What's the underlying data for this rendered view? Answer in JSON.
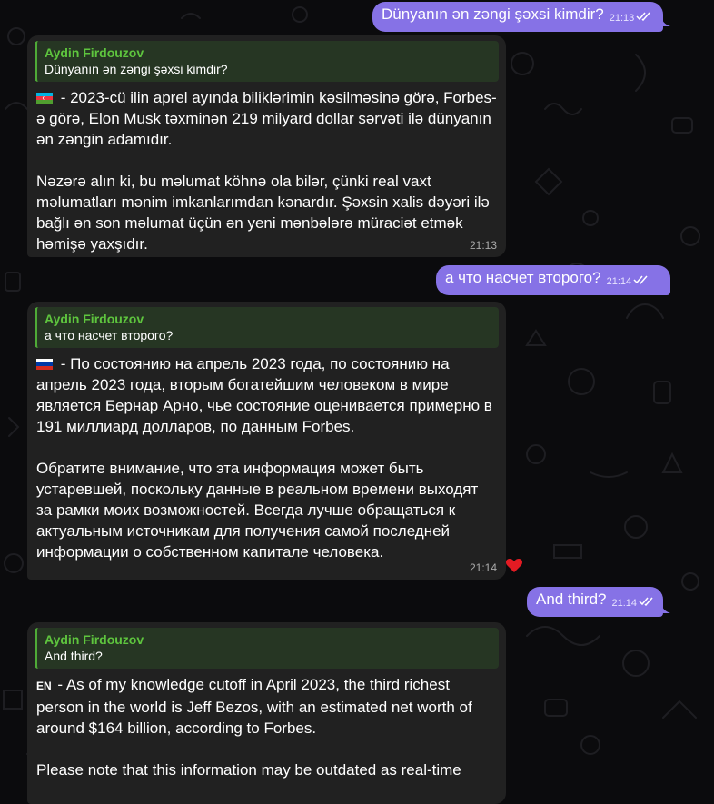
{
  "messages": [
    {
      "type": "outgoing",
      "text": "Dünyanın ən zəngi şəxsi kimdir?",
      "time": "21:13"
    },
    {
      "type": "incoming",
      "reply_name": "Aydin Firdouzov",
      "reply_text": "Dünyanın ən zəngi şəxsi kimdir?",
      "lang_label": "🇦🇿",
      "lang_icon": "azerbaijan-flag-icon",
      "p1": " - 2023-cü ilin aprel ayında biliklərimin kəsilməsinə görə, Forbes-ə görə, Elon Musk təxminən 219 milyard dollar sərvəti ilə dünyanın ən zəngin adamıdır.",
      "p2": "Nəzərə alın ki, bu məlumat köhnə ola bilər, çünki real vaxt məlumatları mənim imkanlarımdan kənardır. Şəxsin xalis dəyəri ilə bağlı ən son məlumat üçün ən yeni mənbələrə müraciət etmək həmişə yaxşıdır.",
      "time": "21:13"
    },
    {
      "type": "outgoing",
      "text": "а что насчет второго?",
      "time": "21:14"
    },
    {
      "type": "incoming",
      "reply_name": "Aydin Firdouzov",
      "reply_text": "а что насчет второго?",
      "lang_label": "🇷🇺",
      "lang_icon": "russia-flag-icon",
      "p1": " - По состоянию на апрель 2023 года, по состоянию на апрель 2023 года, вторым богатейшим человеком в мире является Бернар Арно, чье состояние оценивается примерно в 191 миллиард долларов, по данным Forbes.",
      "p2": "Обратите внимание, что эта информация может быть устаревшей, поскольку данные в реальном времени выходят за рамки моих возможностей. Всегда лучше обращаться к актуальным источникам для получения самой последней информации о собственном капитале человека.",
      "time": "21:14",
      "reaction": "❤️"
    },
    {
      "type": "outgoing",
      "text": "And third?",
      "time": "21:14"
    },
    {
      "type": "incoming",
      "reply_name": "Aydin Firdouzov",
      "reply_text": "And third?",
      "lang_label": "EN",
      "p1": " - As of my knowledge cutoff in April 2023, the third richest person in the world is Jeff Bezos, with an estimated net worth of around $164 billion, according to Forbes.",
      "p2": "Please note that this information may be outdated as real-time"
    }
  ],
  "colors": {
    "outgoing_bubble": "#8672e6",
    "incoming_bubble": "#212121",
    "reply_accent": "#5ec53e",
    "reply_bar": "#4faa37",
    "background": "#0b0b0d"
  }
}
